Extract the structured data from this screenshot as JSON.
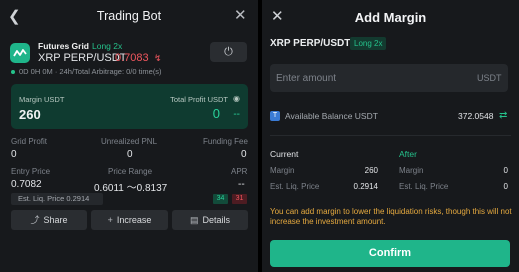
{
  "left": {
    "title": "Trading Bot",
    "bot_name": "Futures Grid",
    "direction": "Long 2x",
    "pair": "XRP PERP/USDT",
    "price": "0.7083",
    "runtime": "0D 0H 0M · 24h/Total Arbitrage: 0/0 time(s)",
    "card": {
      "margin_label": "Margin USDT",
      "margin_value": "260",
      "profit_label": "Total Profit USDT",
      "profit_value": "0",
      "profit_sub": "--"
    },
    "stats": {
      "grid_profit_label": "Grid Profit",
      "grid_profit_value": "0",
      "upnl_label": "Unrealized PNL",
      "upnl_value": "0",
      "funding_label": "Funding Fee",
      "funding_value": "0",
      "entry_label": "Entry Price",
      "entry_value": "0.7082",
      "range_label": "Price Range",
      "range_value": "0.6011 ～0.8137",
      "apr_label": "APR",
      "apr_value": "--"
    },
    "liq_price": "Est. Liq. Price 0.2914",
    "apr_badges": {
      "green": "34",
      "red": "31"
    },
    "buttons": {
      "share": "Share",
      "increase": "Increase",
      "details": "Details"
    }
  },
  "right": {
    "title": "Add Margin",
    "pair": "XRP PERP/USDT",
    "direction": "Long 2x",
    "input_placeholder": "Enter amount",
    "input_unit": "USDT",
    "available_label": "Available Balance USDT",
    "available_value": "372.0548",
    "current": {
      "header": "Current",
      "margin_label": "Margin",
      "margin_value": "260",
      "liq_label": "Est. Liq. Price",
      "liq_value": "0.2914"
    },
    "after": {
      "header": "After",
      "margin_label": "Margin",
      "margin_value": "0",
      "liq_label": "Est. Liq. Price",
      "liq_value": "0"
    },
    "note": "You can add margin to lower the liquidation risks, though this will not increase the investment amount.",
    "confirm_label": "Confirm"
  },
  "icons": {
    "back": "chevron-left-icon",
    "close": "close-icon",
    "power": "power-icon",
    "eye": "eye-icon",
    "share": "share-icon",
    "plus": "plus-icon",
    "details": "document-icon",
    "swap": "swap-icon"
  },
  "colors": {
    "accent_green": "#1fb58a",
    "profit_green": "#29d19a",
    "loss_red": "#f0565e",
    "warning_orange": "#e5a93f",
    "panel_bg": "#17191c"
  }
}
